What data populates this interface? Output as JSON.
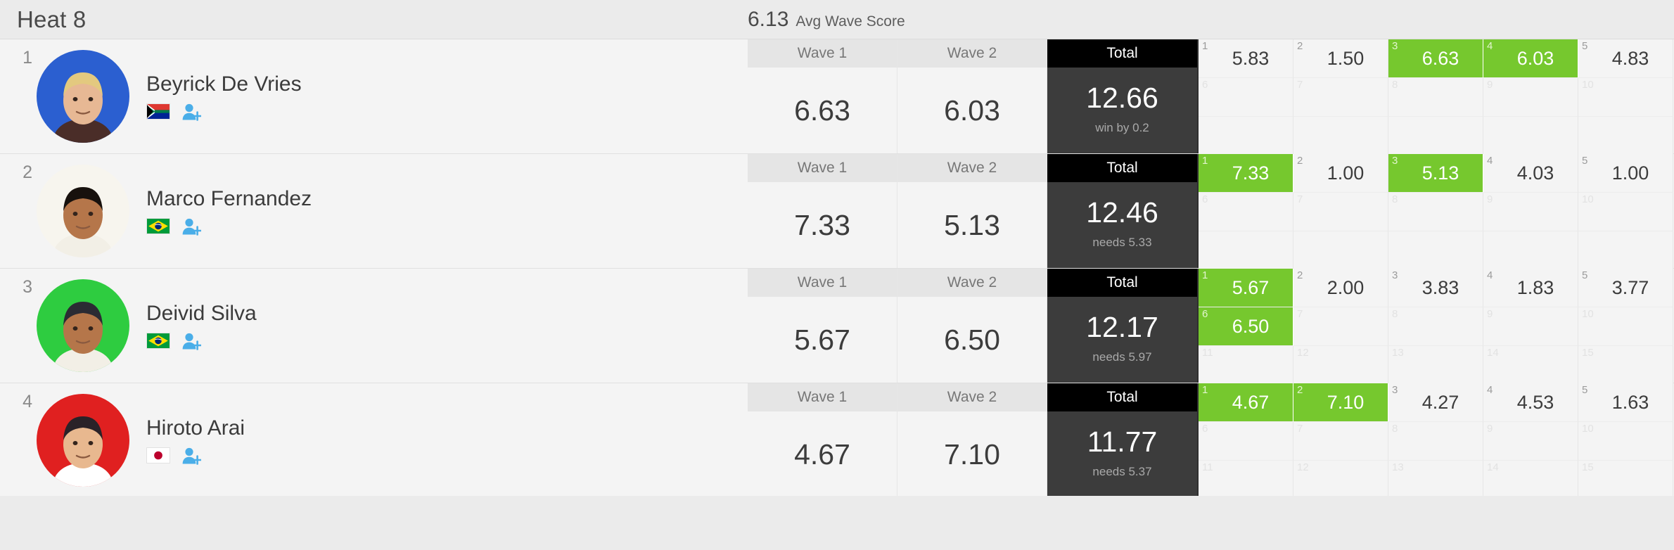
{
  "header": {
    "heat_title": "Heat 8",
    "avg_value": "6.13",
    "avg_label": "Avg Wave Score"
  },
  "columns": {
    "wave1": "Wave 1",
    "wave2": "Wave 2",
    "total": "Total"
  },
  "colors": {
    "highlight_green": "#76c82e",
    "total_header_bg": "#000000",
    "total_body_bg": "#3c3c3c",
    "page_bg": "#ebebeb",
    "row_bg": "#f4f4f4"
  },
  "icons": {
    "add_user": "add-user-icon"
  },
  "athletes": [
    {
      "rank": "1",
      "name": "Beyrick De Vries",
      "country": "South Africa",
      "flag": "za",
      "avatar_bg": "#2b5fd0",
      "avatar_hair": "#e3c97f",
      "avatar_skin": "#e7b894",
      "avatar_shirt": "#4a2d28",
      "wave1": "6.63",
      "wave2": "6.03",
      "total": "12.66",
      "total_note": "win by 0.2",
      "scores": [
        {
          "idx": "1",
          "value": "5.83",
          "highlight": false
        },
        {
          "idx": "2",
          "value": "1.50",
          "highlight": false
        },
        {
          "idx": "3",
          "value": "6.63",
          "highlight": true
        },
        {
          "idx": "4",
          "value": "6.03",
          "highlight": true
        },
        {
          "idx": "5",
          "value": "4.83",
          "highlight": false
        },
        {
          "idx": "6",
          "value": "",
          "highlight": false
        },
        {
          "idx": "7",
          "value": "",
          "highlight": false
        },
        {
          "idx": "8",
          "value": "",
          "highlight": false
        },
        {
          "idx": "9",
          "value": "",
          "highlight": false
        },
        {
          "idx": "10",
          "value": "",
          "highlight": false
        }
      ]
    },
    {
      "rank": "2",
      "name": "Marco Fernandez",
      "country": "Brazil",
      "flag": "br",
      "avatar_bg": "#f7f5ee",
      "avatar_hair": "#17110d",
      "avatar_skin": "#b5764a",
      "avatar_shirt": "#f2efe6",
      "wave1": "7.33",
      "wave2": "5.13",
      "total": "12.46",
      "total_note": "needs 5.33",
      "scores": [
        {
          "idx": "1",
          "value": "7.33",
          "highlight": true
        },
        {
          "idx": "2",
          "value": "1.00",
          "highlight": false
        },
        {
          "idx": "3",
          "value": "5.13",
          "highlight": true
        },
        {
          "idx": "4",
          "value": "4.03",
          "highlight": false
        },
        {
          "idx": "5",
          "value": "1.00",
          "highlight": false
        },
        {
          "idx": "6",
          "value": "",
          "highlight": false
        },
        {
          "idx": "7",
          "value": "",
          "highlight": false
        },
        {
          "idx": "8",
          "value": "",
          "highlight": false
        },
        {
          "idx": "9",
          "value": "",
          "highlight": false
        },
        {
          "idx": "10",
          "value": "",
          "highlight": false
        }
      ]
    },
    {
      "rank": "3",
      "name": "Deivid Silva",
      "country": "Brazil",
      "flag": "br",
      "avatar_bg": "#2ecc40",
      "avatar_hair": "#2b2b33",
      "avatar_skin": "#b5764a",
      "avatar_shirt": "#f2efe6",
      "wave1": "5.67",
      "wave2": "6.50",
      "total": "12.17",
      "total_note": "needs 5.97",
      "scores": [
        {
          "idx": "1",
          "value": "5.67",
          "highlight": true
        },
        {
          "idx": "2",
          "value": "2.00",
          "highlight": false
        },
        {
          "idx": "3",
          "value": "3.83",
          "highlight": false
        },
        {
          "idx": "4",
          "value": "1.83",
          "highlight": false
        },
        {
          "idx": "5",
          "value": "3.77",
          "highlight": false
        },
        {
          "idx": "6",
          "value": "6.50",
          "highlight": true
        },
        {
          "idx": "7",
          "value": "",
          "highlight": false
        },
        {
          "idx": "8",
          "value": "",
          "highlight": false
        },
        {
          "idx": "9",
          "value": "",
          "highlight": false
        },
        {
          "idx": "10",
          "value": "",
          "highlight": false
        },
        {
          "idx": "11",
          "value": "",
          "highlight": false
        },
        {
          "idx": "12",
          "value": "",
          "highlight": false
        },
        {
          "idx": "13",
          "value": "",
          "highlight": false
        },
        {
          "idx": "14",
          "value": "",
          "highlight": false
        },
        {
          "idx": "15",
          "value": "",
          "highlight": false
        }
      ]
    },
    {
      "rank": "4",
      "name": "Hiroto Arai",
      "country": "Japan",
      "flag": "jp",
      "avatar_bg": "#e02020",
      "avatar_hair": "#2a2228",
      "avatar_skin": "#e8b88f",
      "avatar_shirt": "#ffffff",
      "wave1": "4.67",
      "wave2": "7.10",
      "total": "11.77",
      "total_note": "needs 5.37",
      "scores": [
        {
          "idx": "1",
          "value": "4.67",
          "highlight": true
        },
        {
          "idx": "2",
          "value": "7.10",
          "highlight": true
        },
        {
          "idx": "3",
          "value": "4.27",
          "highlight": false
        },
        {
          "idx": "4",
          "value": "4.53",
          "highlight": false
        },
        {
          "idx": "5",
          "value": "1.63",
          "highlight": false
        },
        {
          "idx": "6",
          "value": "",
          "highlight": false
        },
        {
          "idx": "7",
          "value": "",
          "highlight": false
        },
        {
          "idx": "8",
          "value": "",
          "highlight": false
        },
        {
          "idx": "9",
          "value": "",
          "highlight": false
        },
        {
          "idx": "10",
          "value": "",
          "highlight": false
        },
        {
          "idx": "11",
          "value": "",
          "highlight": false
        },
        {
          "idx": "12",
          "value": "",
          "highlight": false
        },
        {
          "idx": "13",
          "value": "",
          "highlight": false
        },
        {
          "idx": "14",
          "value": "",
          "highlight": false
        },
        {
          "idx": "15",
          "value": "",
          "highlight": false
        }
      ]
    }
  ]
}
